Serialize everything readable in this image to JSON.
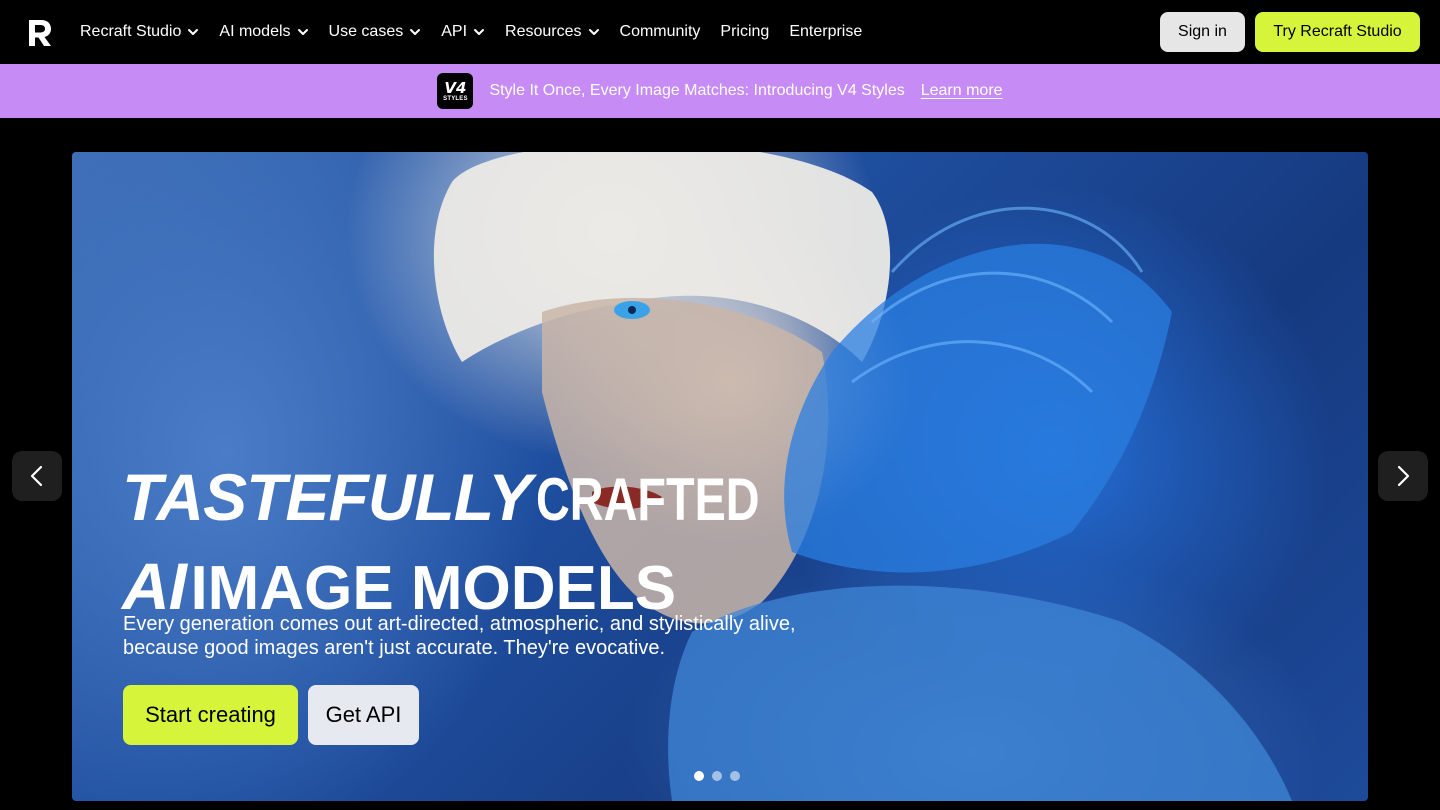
{
  "nav": {
    "items": [
      {
        "label": "Recraft Studio",
        "dropdown": true
      },
      {
        "label": "AI models",
        "dropdown": true
      },
      {
        "label": "Use cases",
        "dropdown": true
      },
      {
        "label": "API",
        "dropdown": true
      },
      {
        "label": "Resources",
        "dropdown": true
      },
      {
        "label": "Community",
        "dropdown": false
      },
      {
        "label": "Pricing",
        "dropdown": false
      },
      {
        "label": "Enterprise",
        "dropdown": false
      }
    ],
    "sign_in": "Sign in",
    "try_button": "Try Recraft Studio"
  },
  "banner": {
    "badge_main": "V4",
    "badge_sub": "STYLES",
    "text": "Style It Once, Every Image Matches: Introducing V4 Styles",
    "link": "Learn more"
  },
  "hero": {
    "title_word1": "TASTEFULLY",
    "title_word2": "CRAFTED",
    "title_word3": "AI",
    "title_word4": "IMAGE MODELS",
    "subtitle": "Every generation comes out art-directed, atmospheric, and stylistically alive, because good images aren't just accurate. They're evocative.",
    "primary_button": "Start creating",
    "secondary_button": "Get API",
    "slides_total": 3,
    "active_slide": 1
  },
  "colors": {
    "accent": "#d6f53a",
    "banner_bg": "#c68bf5",
    "nav_bg": "#000000"
  }
}
